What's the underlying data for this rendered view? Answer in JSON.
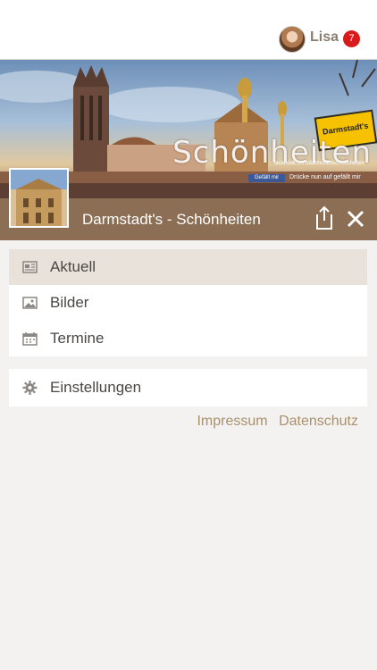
{
  "header": {
    "user_name": "Lisa",
    "notification_count": "7"
  },
  "banner": {
    "title": "Schönheiten",
    "subtitle": "facebook.com/darmstadtschoenheiten",
    "sign_text": "Darmstadt's",
    "like_button": "Gefällt mir",
    "like_hint": "Drücke nun auf gefällt mir"
  },
  "page": {
    "title": "Darmstadt's - Schönheiten"
  },
  "menu": {
    "items": [
      {
        "label": "Aktuell",
        "icon": "newspaper-icon",
        "active": true
      },
      {
        "label": "Bilder",
        "icon": "image-icon",
        "active": false
      },
      {
        "label": "Termine",
        "icon": "calendar-icon",
        "active": false
      }
    ],
    "settings": {
      "label": "Einstellungen",
      "icon": "gear-icon"
    }
  },
  "footer_links": {
    "impressum": "Impressum",
    "datenschutz": "Datenschutz"
  },
  "colors": {
    "page_bar": "#8b6e53",
    "accent_link": "#a8916f",
    "badge": "#d91a1a",
    "active_item": "#e8e2db"
  }
}
